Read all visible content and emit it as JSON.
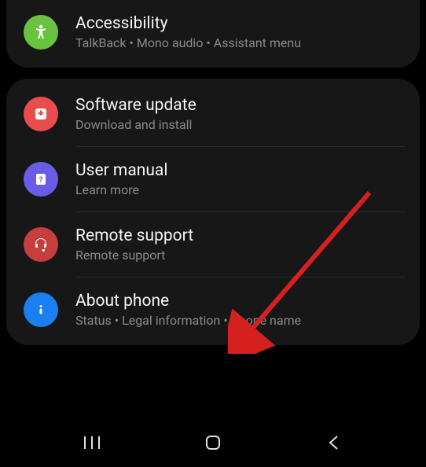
{
  "group1": {
    "accessibility": {
      "title": "Accessibility",
      "subtitle": "TalkBack • Mono audio • Assistant menu"
    }
  },
  "group2": {
    "software_update": {
      "title": "Software update",
      "subtitle": "Download and install"
    },
    "user_manual": {
      "title": "User manual",
      "subtitle": "Learn more"
    },
    "remote_support": {
      "title": "Remote support",
      "subtitle": "Remote support"
    },
    "about_phone": {
      "title": "About phone",
      "subtitle": "Status • Legal information • Phone name"
    }
  }
}
